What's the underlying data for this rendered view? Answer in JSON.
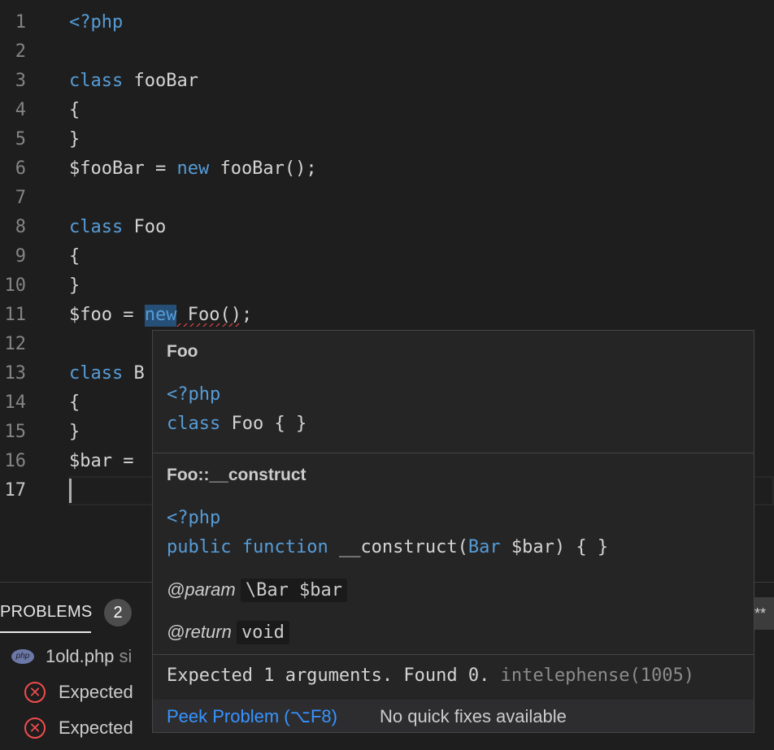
{
  "editor": {
    "lines": [
      {
        "num": "1",
        "tokens": [
          {
            "t": "<?php",
            "c": "tag"
          }
        ]
      },
      {
        "num": "2",
        "tokens": []
      },
      {
        "num": "3",
        "tokens": [
          {
            "t": "class",
            "c": "kw"
          },
          {
            "t": " fooBar",
            "c": ""
          }
        ]
      },
      {
        "num": "4",
        "tokens": [
          {
            "t": "{",
            "c": ""
          }
        ]
      },
      {
        "num": "5",
        "tokens": [
          {
            "t": "}",
            "c": ""
          }
        ]
      },
      {
        "num": "6",
        "tokens": [
          {
            "t": "$fooBar = ",
            "c": ""
          },
          {
            "t": "new",
            "c": "kw"
          },
          {
            "t": " fooBar();",
            "c": ""
          }
        ]
      },
      {
        "num": "7",
        "tokens": []
      },
      {
        "num": "8",
        "tokens": [
          {
            "t": "class",
            "c": "kw"
          },
          {
            "t": " Foo",
            "c": ""
          }
        ]
      },
      {
        "num": "9",
        "tokens": [
          {
            "t": "{",
            "c": ""
          }
        ]
      },
      {
        "num": "10",
        "tokens": [
          {
            "t": "}",
            "c": ""
          }
        ]
      },
      {
        "num": "11",
        "tokens": [
          {
            "t": "$foo = ",
            "c": ""
          },
          {
            "t": "new",
            "c": "kw hl squiggle"
          },
          {
            "t": " Foo()",
            "c": "squiggle"
          },
          {
            "t": ";",
            "c": ""
          }
        ]
      },
      {
        "num": "12",
        "tokens": []
      },
      {
        "num": "13",
        "tokens": [
          {
            "t": "class",
            "c": "kw"
          },
          {
            "t": " B",
            "c": ""
          }
        ]
      },
      {
        "num": "14",
        "tokens": [
          {
            "t": "{",
            "c": ""
          }
        ]
      },
      {
        "num": "15",
        "tokens": [
          {
            "t": "}",
            "c": ""
          }
        ]
      },
      {
        "num": "16",
        "tokens": [
          {
            "t": "$bar = ",
            "c": ""
          }
        ]
      },
      {
        "num": "17",
        "tokens": []
      }
    ]
  },
  "hover": {
    "section1": {
      "title": "Foo",
      "php_tag": "<?php",
      "kw": "class",
      "rest": " Foo { }"
    },
    "section2": {
      "title": "Foo::__construct",
      "php_tag": "<?php",
      "kw1": "public",
      "kw2": "function",
      "fn": " __construct(",
      "type": "Bar",
      "rest": " $bar) { }",
      "param_label": "@param",
      "param_value": "\\Bar $bar",
      "return_label": "@return",
      "return_value": "void"
    },
    "diagnostic": {
      "message": "Expected 1 arguments. Found 0.",
      "source": " intelephense(1005)"
    },
    "status": {
      "peek_label": "Peek Problem (⌥F8)",
      "no_fix_label": "No quick fixes available"
    }
  },
  "panel": {
    "tab_label": "PROBLEMS",
    "badge_count": "2",
    "more_label": "**",
    "file_icon_label": "php",
    "file_name": "1old.php",
    "file_path_partial": " si",
    "problems": [
      {
        "text": "Expected"
      },
      {
        "text": "Expected"
      }
    ]
  },
  "colors": {
    "editor_bg": "#1e1e1e",
    "keyword": "#569cd6",
    "error": "#f14c4c",
    "link": "#3794ff",
    "hover_bg": "#252526"
  }
}
